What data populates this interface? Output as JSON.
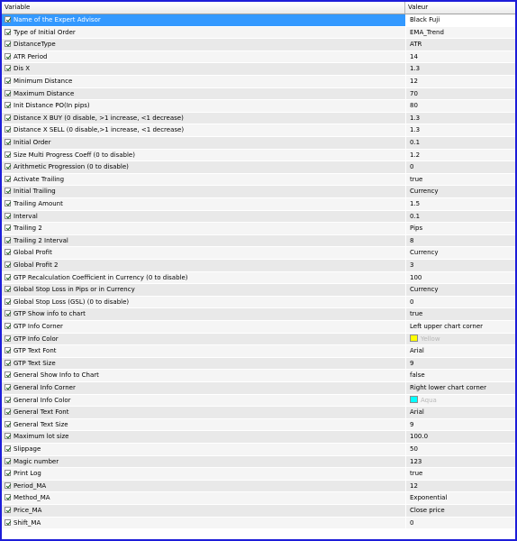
{
  "header": {
    "variable_label": "Variable",
    "value_label": "Valeur"
  },
  "rows": [
    {
      "name": "Name of the Expert Advisor",
      "value": "Black Fuji",
      "selected": true
    },
    {
      "name": "Type of Initial Order",
      "value": "EMA_Trend"
    },
    {
      "name": "DistanceType",
      "value": "ATR"
    },
    {
      "name": "ATR Period",
      "value": "14"
    },
    {
      "name": "Dis X",
      "value": "1.3"
    },
    {
      "name": "Minimum Distance",
      "value": "12"
    },
    {
      "name": "Maximum Distance",
      "value": "70"
    },
    {
      "name": "Init Distance PO(In pips)",
      "value": "80"
    },
    {
      "name": "Distance X BUY (0 disable, >1 increase, <1 decrease)",
      "value": "1.3"
    },
    {
      "name": "Distance X SELL (0 disable,>1 increase, <1 decrease)",
      "value": "1.3"
    },
    {
      "name": "Initial Order",
      "value": "0.1"
    },
    {
      "name": "Size Multi Progress Coeff (0 to disable)",
      "value": "1.2"
    },
    {
      "name": "Arithmetic Progression (0 to disable)",
      "value": "0"
    },
    {
      "name": "Activate Trailing",
      "value": "true"
    },
    {
      "name": "Initial Trailing",
      "value": "Currency"
    },
    {
      "name": "Trailing Amount",
      "value": "1.5"
    },
    {
      "name": "Interval",
      "value": "0.1"
    },
    {
      "name": "Trailing 2",
      "value": "Pips"
    },
    {
      "name": "Trailing 2 Interval",
      "value": "8"
    },
    {
      "name": "Global Profit",
      "value": "Currency"
    },
    {
      "name": "Global  Profit 2",
      "value": "3"
    },
    {
      "name": "GTP Recalculation Coefficient in Currency (0 to disable)",
      "value": "100"
    },
    {
      "name": "Global Stop Loss  in Pips or in Currency",
      "value": "Currency"
    },
    {
      "name": "Global Stop Loss (GSL) (0 to disable)",
      "value": "0"
    },
    {
      "name": "GTP Show info to chart",
      "value": "true"
    },
    {
      "name": "GTP Info Corner",
      "value": "Left upper chart corner"
    },
    {
      "name": "GTP Info Color",
      "value": "Yellow",
      "color": "#ffff00"
    },
    {
      "name": "GTP Text Font",
      "value": "Arial"
    },
    {
      "name": "GTP Text Size",
      "value": "9"
    },
    {
      "name": "General Show Info to Chart",
      "value": "false"
    },
    {
      "name": "General Info Corner",
      "value": "Right lower chart corner"
    },
    {
      "name": "General Info Color",
      "value": "Aqua",
      "color": "#00ffff"
    },
    {
      "name": "General Text Font",
      "value": "Arial"
    },
    {
      "name": "General Text Size",
      "value": "9"
    },
    {
      "name": "Maximum lot size",
      "value": "100.0"
    },
    {
      "name": "Slippage",
      "value": "50"
    },
    {
      "name": "Magic number",
      "value": "123"
    },
    {
      "name": "Print Log",
      "value": "true"
    },
    {
      "name": "Period_MA",
      "value": "12"
    },
    {
      "name": "Method_MA",
      "value": "Exponential"
    },
    {
      "name": "Price_MA",
      "value": "Close price"
    },
    {
      "name": "Shift_MA",
      "value": "0"
    }
  ]
}
